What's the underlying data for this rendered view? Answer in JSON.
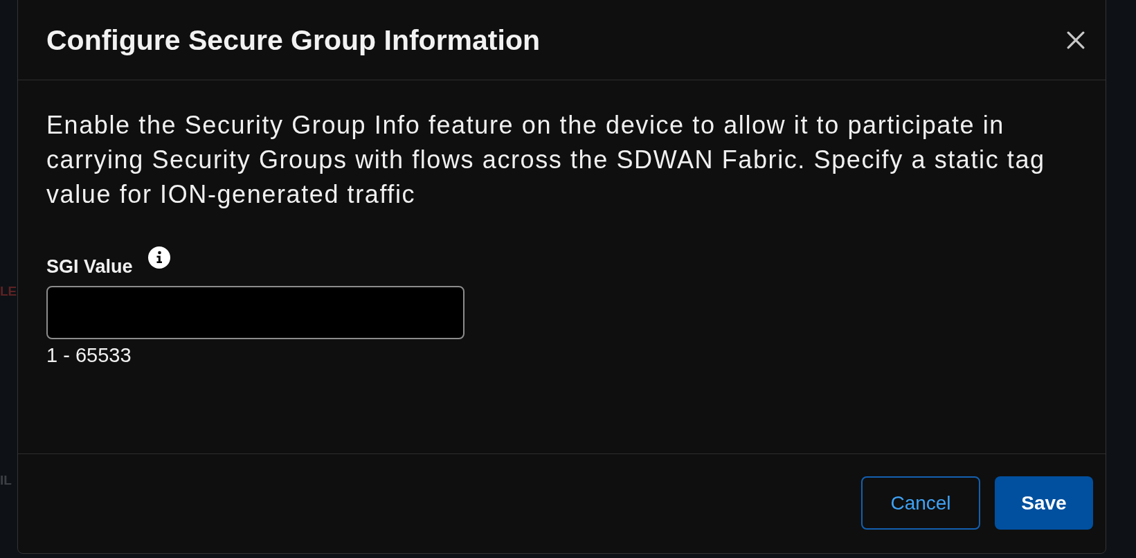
{
  "background": {
    "fragments": [
      {
        "text": "LE",
        "kind": "alert"
      },
      {
        "text": "IL",
        "kind": "muted"
      }
    ]
  },
  "dialog": {
    "title": "Configure Secure Group Information",
    "description": "Enable the Security Group Info feature on the device to allow it to participate in carrying Security Groups with flows across the SDWAN Fabric. Specify a static tag value for ION-generated traffic",
    "field": {
      "label": "SGI Value",
      "hint": "1 - 65533"
    },
    "buttons": [
      {
        "label": "Cancel",
        "kind": "secondary"
      },
      {
        "label": "Save",
        "kind": "primary"
      }
    ]
  }
}
